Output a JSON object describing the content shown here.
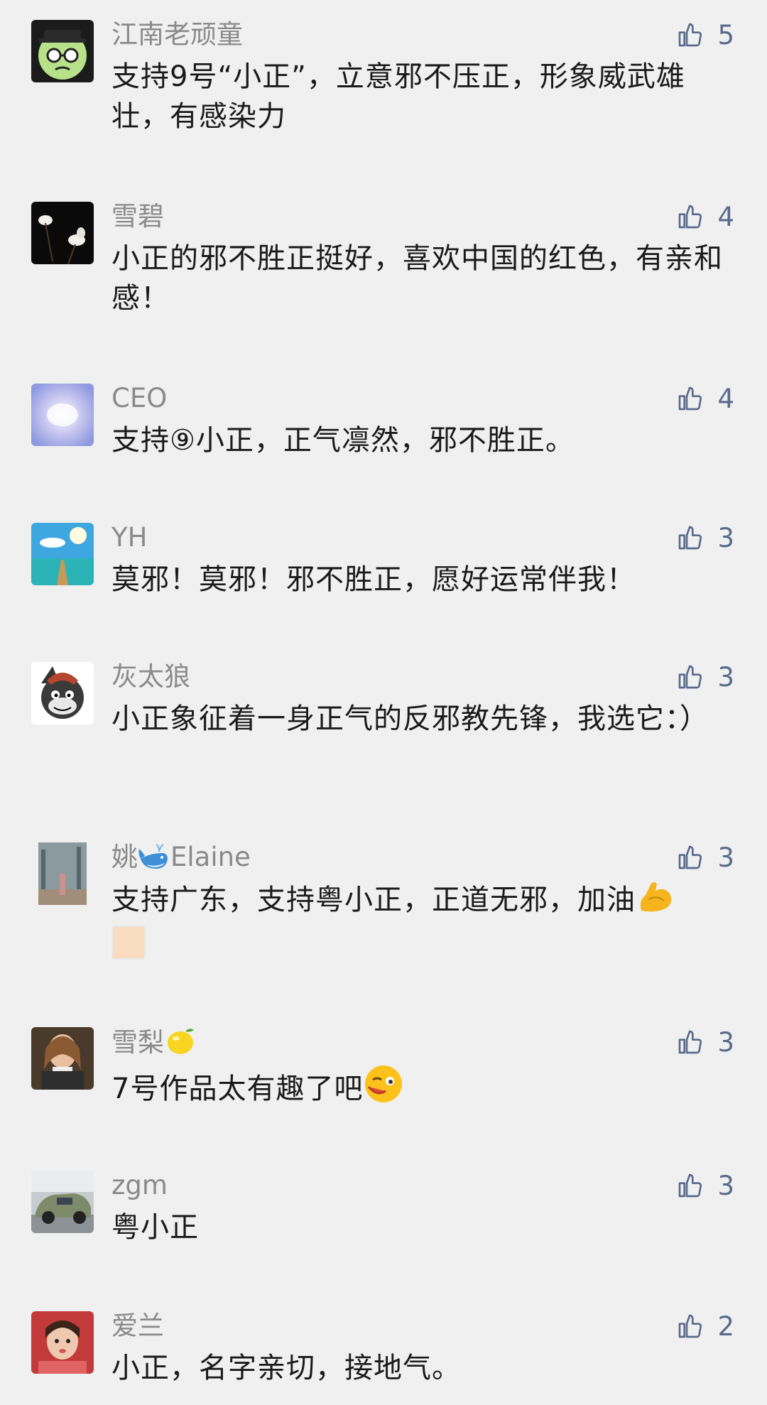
{
  "comments": [
    {
      "name": "江南老顽童",
      "likes": "5",
      "text": "支持9号“小正”，立意邪不压正，形象威武雄壮，有感染力"
    },
    {
      "name": "雪碧",
      "likes": "4",
      "text": "小正的邪不胜正挺好，喜欢中国的红色，有亲和感！"
    },
    {
      "name": "CEO",
      "likes": "4",
      "text": "支持⑨小正，正气凛然，邪不胜正。"
    },
    {
      "name": "YH",
      "likes": "3",
      "text": "莫邪！莫邪！邪不胜正，愿好运常伴我！"
    },
    {
      "name": "灰太狼",
      "likes": "3",
      "text": "小正象征着一身正气的反邪教先锋，我选它：）"
    },
    {
      "name_a": "姚",
      "name_b": "Elaine",
      "likes": "3",
      "text": "支持广东，支持粤小正，正道无邪，加油"
    },
    {
      "name": "雪梨",
      "likes": "3",
      "text": "7号作品太有趣了吧"
    },
    {
      "name": "zgm",
      "likes": "3",
      "text": "粤小正"
    },
    {
      "name": "爱兰",
      "likes": "2",
      "text": "小正，名字亲切，接地气。"
    }
  ],
  "icons": {
    "like": "thumbs-up-icon",
    "whale": "whale-emoji-icon",
    "muscle": "flexed-biceps-emoji-icon",
    "lemon": "lemon-emoji-icon",
    "wink": "winking-face-emoji-icon"
  },
  "colors": {
    "background": "#f0f0f0",
    "nickname": "#8a8a8a",
    "like": "#5a6a8c",
    "text": "#1a1a1a"
  }
}
